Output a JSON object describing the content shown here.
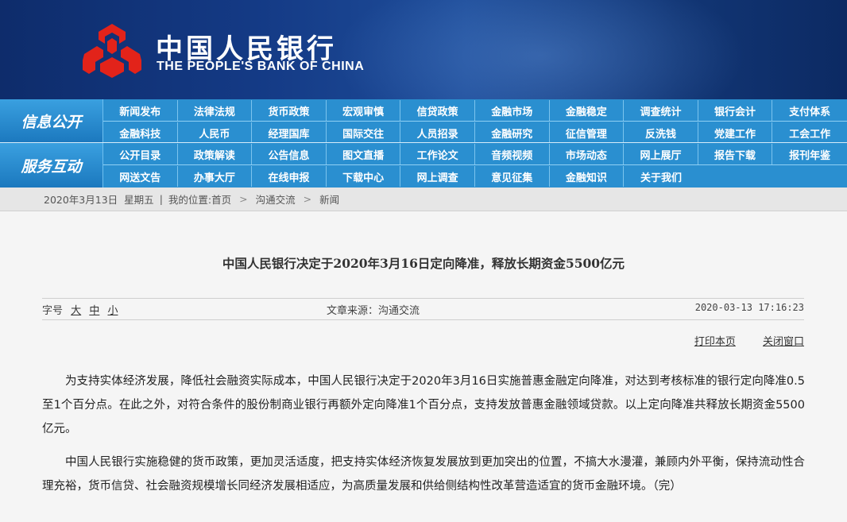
{
  "header": {
    "logo_cn": "中国人民银行",
    "logo_en": "THE PEOPLE'S BANK OF CHINA",
    "colors": {
      "header_bg": "#143a85",
      "logo_red": "#e2231a",
      "nav_bg": "#2a8fd0"
    }
  },
  "nav": {
    "info": {
      "category": "信息公开",
      "row1": [
        "新闻发布",
        "法律法规",
        "货币政策",
        "宏观审慎",
        "信贷政策",
        "金融市场",
        "金融稳定",
        "调查统计",
        "银行会计",
        "支付体系"
      ],
      "row2": [
        "金融科技",
        "人民币",
        "经理国库",
        "国际交往",
        "人员招录",
        "金融研究",
        "征信管理",
        "反洗钱",
        "党建工作",
        "工会工作"
      ]
    },
    "service": {
      "category": "服务互动",
      "row1": [
        "公开目录",
        "政策解读",
        "公告信息",
        "图文直播",
        "工作论文",
        "音频视频",
        "市场动态",
        "网上展厅",
        "报告下载",
        "报刊年鉴"
      ],
      "row2": [
        "网送文告",
        "办事大厅",
        "在线申报",
        "下载中心",
        "网上调查",
        "意见征集",
        "金融知识",
        "关于我们"
      ]
    }
  },
  "breadcrumb": {
    "date": "2020年3月13日",
    "weekday": "星期五",
    "divider": "|",
    "location_label": "我的位置:",
    "items": [
      "首页",
      "沟通交流",
      "新闻"
    ],
    "separator": ">"
  },
  "article": {
    "title": "中国人民银行决定于2020年3月16日定向降准，释放长期资金5500亿元",
    "font_size_label": "字号",
    "font_sizes": [
      "大",
      "中",
      "小"
    ],
    "source": "文章来源：沟通交流",
    "datetime": "2020-03-13 17:16:23",
    "print_label": "打印本页",
    "close_label": "关闭窗口",
    "paragraphs": [
      "为支持实体经济发展，降低社会融资实际成本，中国人民银行决定于2020年3月16日实施普惠金融定向降准，对达到考核标准的银行定向降准0.5至1个百分点。在此之外，对符合条件的股份制商业银行再额外定向降准1个百分点，支持发放普惠金融领域贷款。以上定向降准共释放长期资金5500亿元。",
      "中国人民银行实施稳健的货币政策，更加灵活适度，把支持实体经济恢复发展放到更加突出的位置，不搞大水漫灌，兼顾内外平衡，保持流动性合理充裕，货币信贷、社会融资规模增长同经济发展相适应，为高质量发展和供给侧结构性改革营造适宜的货币金融环境。（完）"
    ]
  }
}
